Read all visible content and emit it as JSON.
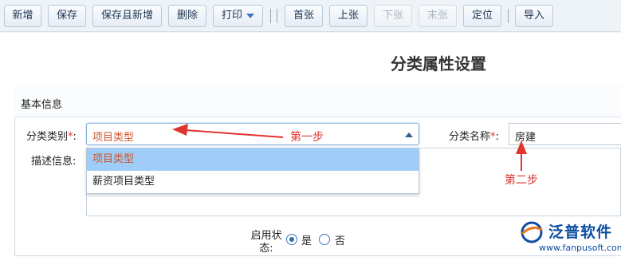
{
  "toolbar": {
    "buttons": [
      {
        "label": "新增",
        "enabled": true
      },
      {
        "label": "保存",
        "enabled": true
      },
      {
        "label": "保存且新增",
        "enabled": true
      },
      {
        "label": "删除",
        "enabled": true
      },
      {
        "label": "打印",
        "enabled": true,
        "has_dropdown": true
      },
      {
        "label": "首张",
        "enabled": true
      },
      {
        "label": "上张",
        "enabled": true
      },
      {
        "label": "下张",
        "enabled": false
      },
      {
        "label": "末张",
        "enabled": false
      },
      {
        "label": "定位",
        "enabled": true
      },
      {
        "label": "导入",
        "enabled": true
      }
    ]
  },
  "page": {
    "title": "分类属性设置"
  },
  "section": {
    "title": "基本信息"
  },
  "form": {
    "category_type": {
      "label": "分类类别",
      "required_mark": "*",
      "colon": ":",
      "value": "项目类型",
      "options": [
        "项目类型",
        "薪资项目类型"
      ],
      "selected_index": 0
    },
    "category_name": {
      "label": "分类名称",
      "required_mark": "*",
      "colon": ":",
      "value": "房建"
    },
    "description": {
      "label": "描述信息:",
      "value": ""
    },
    "status": {
      "label_line1": "启用状",
      "label_line2": "态:",
      "options": [
        "是",
        "否"
      ],
      "selected": "是"
    }
  },
  "annotations": {
    "step1": "第一步",
    "step2": "第二步",
    "color": "#e0342f"
  },
  "watermark": {
    "brand": "泛普软件",
    "url": "www.fanpusoft.com"
  },
  "colors": {
    "accent": "#3f78b8",
    "selected_option_bg": "#9fcdf7",
    "selected_value_text": "#d2582b",
    "brand": "#0d4da1"
  }
}
